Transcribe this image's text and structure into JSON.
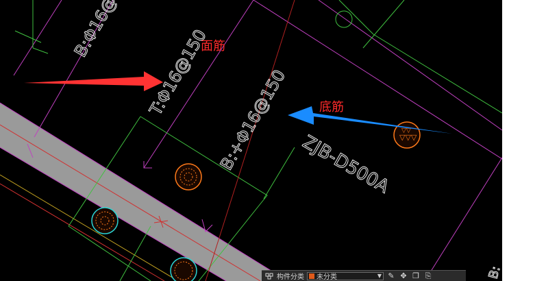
{
  "labels": {
    "rebar_b_top": "B:Φ16@150",
    "rebar_t": "T:Φ16@150",
    "rebar_b_mid": "B:+Φ16@150",
    "beam_code": "ZJB-D500A",
    "annotation_top": "面筋",
    "annotation_bottom": "底筋",
    "corner_text": "B:"
  },
  "statusbar": {
    "label": "构件分类",
    "selected": "未分类",
    "swatch_color": "#e05a1a"
  },
  "colors": {
    "background": "#000000",
    "magenta_line": "#c040c0",
    "green_line": "#40c040",
    "beam_fill": "#9a9a9a",
    "red_arrow": "#ff3333",
    "blue_arrow": "#1a8cff",
    "pile_fill": "#ff7a1a",
    "pile_ring": "#2ad4d4"
  },
  "icons": [
    "layer-icon",
    "edit-icon",
    "move-icon",
    "copy-icon",
    "paste-icon"
  ]
}
